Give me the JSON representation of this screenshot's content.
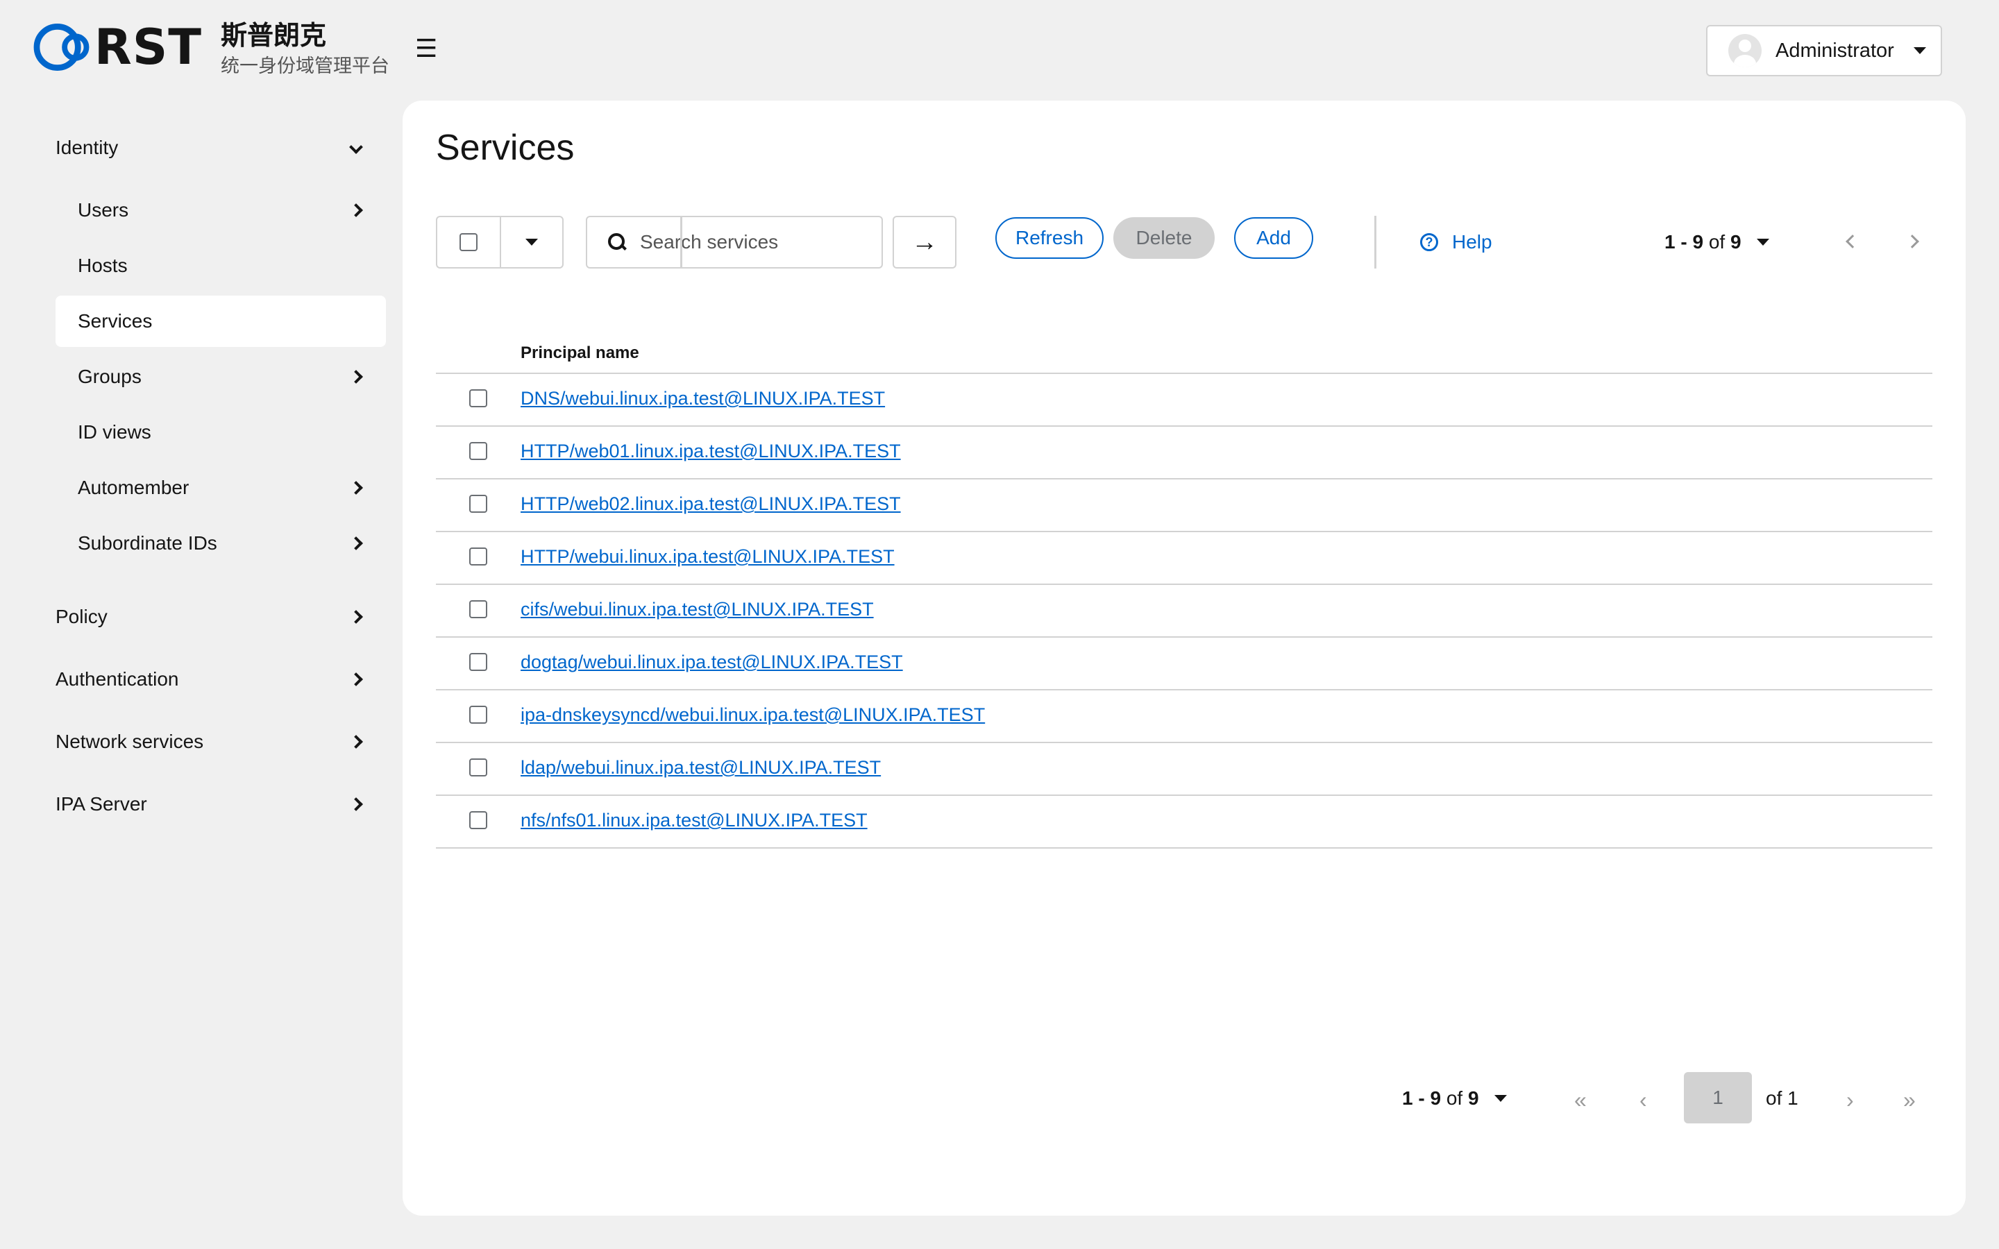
{
  "header": {
    "logo_text": "RST",
    "brand_name": "斯普朗克",
    "brand_subtitle": "统一身份域管理平台",
    "user_name": "Administrator"
  },
  "sidebar": {
    "items": [
      {
        "label": "Identity",
        "expanded": true
      },
      {
        "label": "Users"
      },
      {
        "label": "Hosts"
      },
      {
        "label": "Services",
        "active": true
      },
      {
        "label": "Groups"
      },
      {
        "label": "ID views"
      },
      {
        "label": "Automember"
      },
      {
        "label": "Subordinate IDs"
      },
      {
        "label": "Policy"
      },
      {
        "label": "Authentication"
      },
      {
        "label": "Network services"
      },
      {
        "label": "IPA Server"
      }
    ]
  },
  "main": {
    "title": "Services",
    "search": {
      "placeholder": "Search services"
    },
    "buttons": {
      "refresh": "Refresh",
      "delete": "Delete",
      "add": "Add",
      "help": "Help"
    },
    "pagination": {
      "range": "1 - 9",
      "of_label": "of",
      "total": "9",
      "current_page": "1",
      "page_of": "of 1"
    },
    "table": {
      "header": "Principal name",
      "rows": [
        "DNS/webui.linux.ipa.test@LINUX.IPA.TEST",
        "HTTP/web01.linux.ipa.test@LINUX.IPA.TEST",
        "HTTP/web02.linux.ipa.test@LINUX.IPA.TEST",
        "HTTP/webui.linux.ipa.test@LINUX.IPA.TEST",
        "cifs/webui.linux.ipa.test@LINUX.IPA.TEST",
        "dogtag/webui.linux.ipa.test@LINUX.IPA.TEST",
        "ipa-dnskeysyncd/webui.linux.ipa.test@LINUX.IPA.TEST",
        "ldap/webui.linux.ipa.test@LINUX.IPA.TEST",
        "nfs/nfs01.linux.ipa.test@LINUX.IPA.TEST"
      ]
    }
  },
  "colors": {
    "link": "#0066cc",
    "border": "#d2d2d2",
    "background": "#f0f0f0"
  }
}
